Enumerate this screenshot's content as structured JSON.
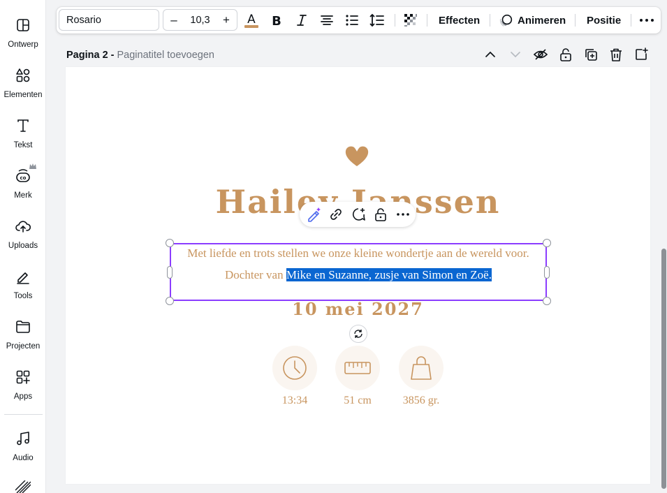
{
  "sidebar": {
    "items": [
      {
        "label": "Ontwerp",
        "icon": "design-icon"
      },
      {
        "label": "Elementen",
        "icon": "elements-icon"
      },
      {
        "label": "Tekst",
        "icon": "text-icon"
      },
      {
        "label": "Merk",
        "icon": "brand-icon"
      },
      {
        "label": "Uploads",
        "icon": "upload-cloud-icon"
      },
      {
        "label": "Tools",
        "icon": "pen-tool-icon"
      },
      {
        "label": "Projecten",
        "icon": "folder-icon"
      },
      {
        "label": "Apps",
        "icon": "apps-grid-icon"
      },
      {
        "label": "Audio",
        "icon": "music-note-icon"
      }
    ]
  },
  "toolbar": {
    "font_name": "Rosario",
    "font_size": "10,3",
    "decrease_label": "–",
    "increase_label": "+",
    "text_color": "#c8955f",
    "effects_label": "Effecten",
    "animate_label": "Animeren",
    "position_label": "Positie"
  },
  "page": {
    "number_label": "Pagina 2 -",
    "title_placeholder": "Paginatitel toevoegen"
  },
  "design": {
    "name": "Hailey Janssen",
    "line1": "Met liefde en trots stellen we onze kleine wondertje aan de wereld voor.",
    "line2_prefix": "Dochter van ",
    "line2_selected": "Mike en Suzanne, zusje van Simon en Zoë.",
    "date": "10 mei 2027",
    "stats": [
      {
        "icon": "clock-icon",
        "value": "13:34"
      },
      {
        "icon": "ruler-icon",
        "value": "51 cm"
      },
      {
        "icon": "bag-icon",
        "value": "3856 gr."
      }
    ],
    "accent_color": "#c8955f",
    "selection_color": "#8b3dff",
    "highlight_color": "#0a66d1"
  }
}
